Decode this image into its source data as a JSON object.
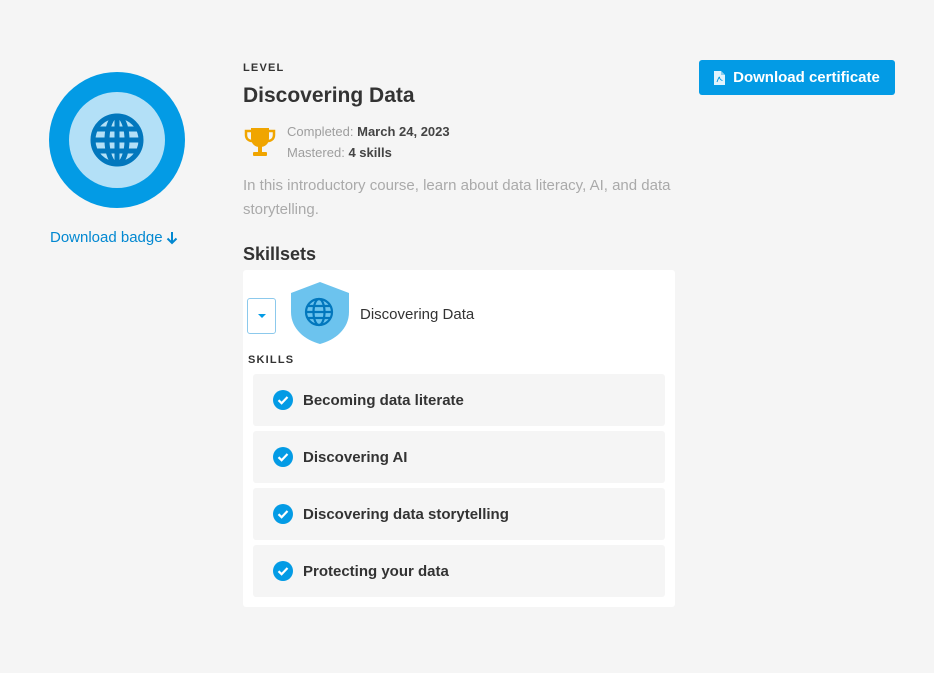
{
  "badge": {
    "icon": "globe-icon",
    "download_label": "Download badge",
    "download_icon": "arrow-down-icon"
  },
  "level": {
    "eyebrow": "LEVEL",
    "title": "Discovering Data",
    "completed_label": "Completed:",
    "completed_value": "March 24, 2023",
    "mastered_label": "Mastered:",
    "mastered_value": "4 skills",
    "description": "In this introductory course, learn about data literacy, AI, and data storytelling."
  },
  "skillsets": {
    "heading": "Skillsets",
    "name": "Discovering Data",
    "skills_label": "SKILLS",
    "skills": [
      "Becoming data literate",
      "Discovering AI",
      "Discovering data storytelling",
      "Protecting your data"
    ]
  },
  "actions": {
    "download_certificate": "Download certificate"
  },
  "colors": {
    "accent": "#039be5",
    "accent_light": "#b3e0f7",
    "trophy": "#f0a500",
    "background": "#f5f5f5"
  }
}
